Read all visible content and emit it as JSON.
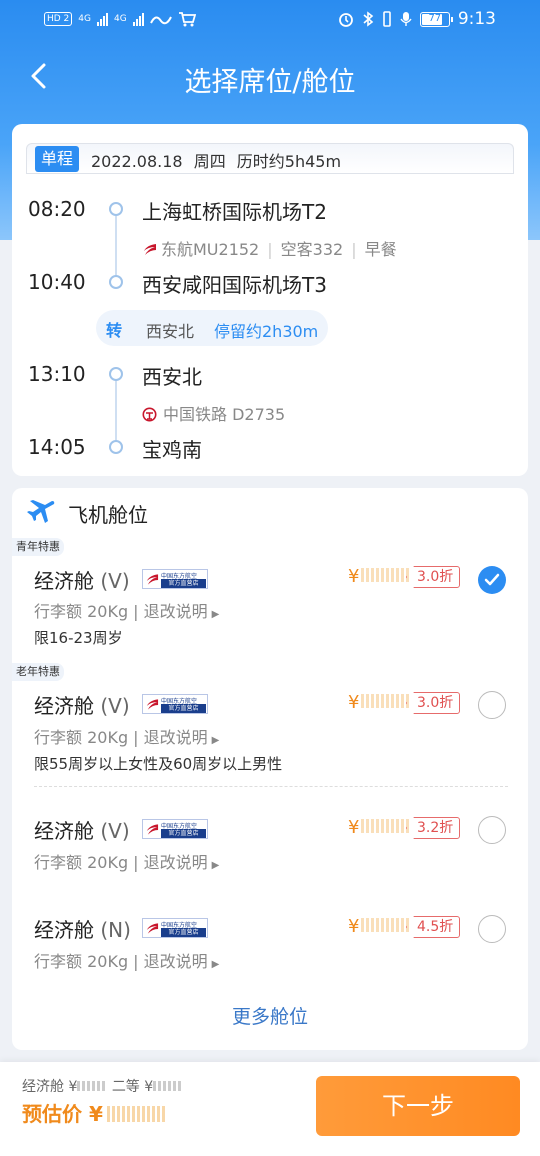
{
  "status_bar": {
    "time": "9:13",
    "battery": "77",
    "hd": "HD 2",
    "net1": "4G",
    "net2": "4G"
  },
  "nav": {
    "title": "选择席位/舱位"
  },
  "summary": {
    "tag": "单程",
    "text": "2022.08.18  周四  历时约5h45m"
  },
  "segments": [
    {
      "time": "08:20",
      "station": "上海虹桥国际机场T2"
    },
    {
      "time": "10:40",
      "station": "西安咸阳国际机场T3"
    },
    {
      "time": "13:10",
      "station": "西安北"
    },
    {
      "time": "14:05",
      "station": "宝鸡南"
    }
  ],
  "flight_info": {
    "carrier": "东航MU2152",
    "aircraft": "空客332",
    "meal": "早餐",
    "sep": "|"
  },
  "rail_info": {
    "carrier": "中国铁路 D2735"
  },
  "transfer": {
    "tag": "转",
    "station": "西安北",
    "stay": "停留约2h30m"
  },
  "cabins": {
    "title": "飞机舱位",
    "badge_top": "中国东方航空",
    "badge_bottom": "官方直营店",
    "items": [
      {
        "promo": "青年特惠",
        "name": "经济舱",
        "code": "(V)",
        "luggage": "行李额 20Kg | 退改说明",
        "restriction": "限16-23周岁",
        "currency": "¥",
        "discount": "3.0折",
        "selected": true
      },
      {
        "promo": "老年特惠",
        "name": "经济舱",
        "code": "(V)",
        "luggage": "行李额 20Kg | 退改说明",
        "restriction": "限55周岁以上女性及60周岁以上男性",
        "currency": "¥",
        "discount": "3.0折",
        "selected": false
      },
      {
        "promo": "",
        "name": "经济舱",
        "code": "(V)",
        "luggage": "行李额 20Kg | 退改说明",
        "restriction": "",
        "currency": "¥",
        "discount": "3.2折",
        "selected": false
      },
      {
        "promo": "",
        "name": "经济舱",
        "code": "(N)",
        "luggage": "行李额 20Kg | 退改说明",
        "restriction": "",
        "currency": "¥",
        "discount": "4.5折",
        "selected": false
      }
    ],
    "more": "更多舱位"
  },
  "bottom": {
    "fare_label": "经济舱 ¥",
    "fare_second": "二等 ¥",
    "estimate_label": "预估价 ¥",
    "next_label": "下一步"
  },
  "colors": {
    "primary": "#2c8df2",
    "accent": "#ff8a22",
    "price": "#f08a1c",
    "discount": "#e05050"
  }
}
